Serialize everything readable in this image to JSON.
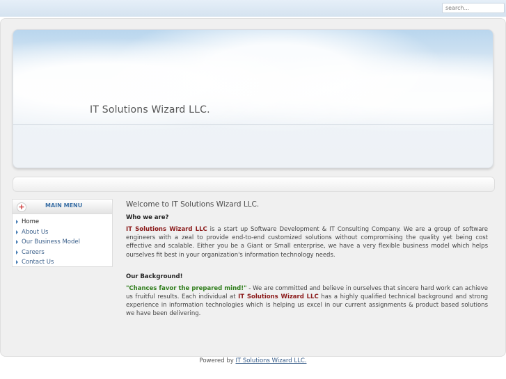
{
  "search": {
    "placeholder": "search..."
  },
  "banner": {
    "title": "IT Solutions Wizard LLC."
  },
  "menu": {
    "title": "MAIN MENU",
    "items": [
      {
        "label": "Home"
      },
      {
        "label": "About Us"
      },
      {
        "label": "Our Business Model"
      },
      {
        "label": "Careers"
      },
      {
        "label": "Contact Us"
      }
    ]
  },
  "content": {
    "welcome": "Welcome to IT Solutions Wizard LLC.",
    "who_heading": "Who we are?",
    "who_brand": "IT Solutions Wizard LLC",
    "who_text": " is a start up Software Development & IT Consulting Company. We are a group of software engineers with a zeal to provide end-to-end customized solutions without compromising the quality yet being cost effective and scalable. Either you be a Giant or Small enterprise, we have a very flexible business model which helps ourselves fit best in your organization's information technology needs.",
    "bg_heading": "Our Background!",
    "bg_quote": "\"Chances favor the prepared mind!\"",
    "bg_text1": " - We are committed and believe in ourselves that sincere hard work can achieve us fruitful results. Each individual at ",
    "bg_brand": "IT Solutions Wizard LLC",
    "bg_text2": " has a highly qualified technical background and strong experience in information technologies which is helping us excel in our current assignments & product based solutions we have been delivering."
  },
  "footer": {
    "prefix": "Powered by ",
    "link": "IT Solutions Wizard LLC."
  },
  "colors": {
    "brand": "#8b1a1a",
    "quote": "#2e7d1a",
    "link": "#3a5f8a",
    "menu_title": "#3a6fa5"
  }
}
